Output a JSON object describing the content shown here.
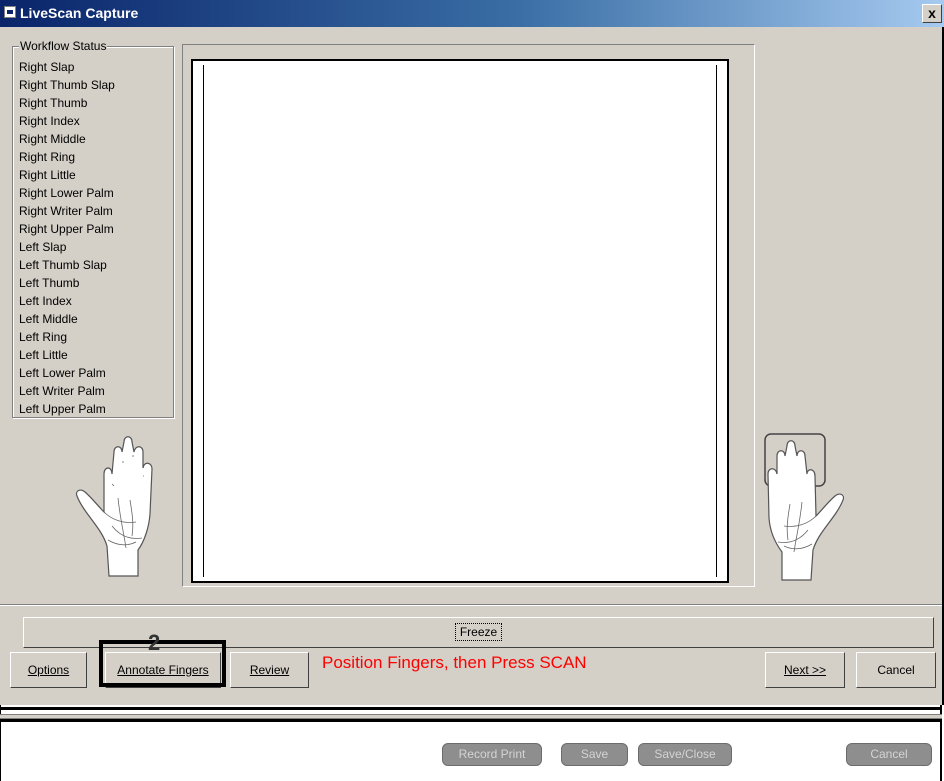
{
  "window": {
    "title": "LiveScan Capture",
    "close_label": "x"
  },
  "workflow": {
    "label": "Workflow Status",
    "items": [
      "Right Slap",
      "Right Thumb Slap",
      "Right Thumb",
      "Right Index",
      "Right Middle",
      "Right Ring",
      "Right Little",
      "Right Lower Palm",
      "Right Writer Palm",
      "Right Upper Palm",
      "Left Slap",
      "Left Thumb Slap",
      "Left Thumb",
      "Left Index",
      "Left Middle",
      "Left Ring",
      "Left Little",
      "Left Lower Palm",
      "Left Writer Palm",
      "Left Upper Palm"
    ]
  },
  "controls": {
    "freeze_label": "Freeze",
    "instruction": "Position Fingers, then Press SCAN",
    "options_label": "Options",
    "annotate_label": "Annotate Fingers",
    "review_label": "Review",
    "next_label": "Next >>",
    "cancel_label": "Cancel"
  },
  "annotation": {
    "callout_number": "2"
  },
  "footer": {
    "record_print_label": "Record Print",
    "save_label": "Save",
    "save_close_label": "Save/Close",
    "cancel_label": "Cancel"
  },
  "colors": {
    "instruction": "#ff0000",
    "titlebar": "#0a246a",
    "panel": "#d4d0c8"
  }
}
